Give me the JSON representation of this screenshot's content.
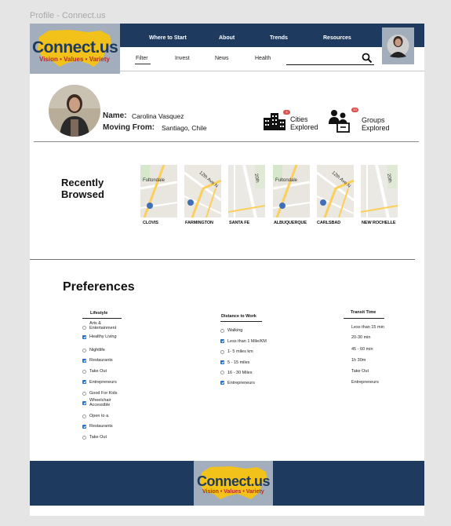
{
  "window": {
    "title": "Profile - Connect.us"
  },
  "brand": {
    "name": "Connect.us",
    "tagline": "Vision • Values • Variety"
  },
  "nav": {
    "primary": [
      "Where to Start",
      "About",
      "Trends",
      "Resources"
    ],
    "secondary": [
      "Filter",
      "Invest",
      "News",
      "Health"
    ],
    "search_placeholder": ""
  },
  "profile": {
    "name_label": "Name:",
    "name_value": "Carolina Vasquez",
    "from_label": "Moving From:",
    "from_value": "Santiago, Chile",
    "cities": {
      "count": "3",
      "line1": "Cities",
      "line2": "Explored"
    },
    "groups": {
      "count": "10",
      "line1": "Groups",
      "line2": "Explored"
    }
  },
  "recently_browsed": {
    "title_line1": "Recently",
    "title_line2": "Browsed",
    "cities": [
      "CLOVIS",
      "FARMINGTON",
      "SANTA FE",
      "ALBUQUERQUE",
      "CARLSBAD",
      "NEW ROCHELLE"
    ],
    "map_labels": [
      "Fultondale",
      "12th Ave N",
      "20th"
    ]
  },
  "preferences": {
    "title": "Preferences",
    "lifestyle": {
      "header": "Lifestyle",
      "options": [
        {
          "label": "Arts & Entertainment",
          "checked": false
        },
        {
          "label": "Healthy Living",
          "checked": true
        },
        {
          "label": "Nightlife",
          "checked": false
        },
        {
          "label": "Restaurants",
          "checked": true
        },
        {
          "label": "Take Out",
          "checked": false
        },
        {
          "label": "Entrepreneurs",
          "checked": true
        },
        {
          "label": "Good For Kids",
          "checked": false
        },
        {
          "label": "Wheelchair Accessible",
          "checked": true
        },
        {
          "label": "Open to a",
          "checked": false
        },
        {
          "label": "Restaurants",
          "checked": true
        },
        {
          "label": "Take Out",
          "checked": false
        }
      ]
    },
    "distance": {
      "header": "Distance to Work",
      "options": [
        {
          "label": "Walking",
          "checked": false
        },
        {
          "label": "Less than 1 Mile/KM",
          "checked": true
        },
        {
          "label": "1- 5 miles km",
          "checked": false
        },
        {
          "label": "5 - 15 miles",
          "checked": true
        },
        {
          "label": "16 - 30 Miles",
          "checked": false
        },
        {
          "label": "Entrepreneurs",
          "checked": true
        }
      ]
    },
    "transit": {
      "header": "Transit Time",
      "options": [
        "Less than 15 min",
        "20-30 min",
        "45 - 60 min",
        "1h 30m",
        "Take Out",
        "Entrepreneurs"
      ]
    }
  }
}
